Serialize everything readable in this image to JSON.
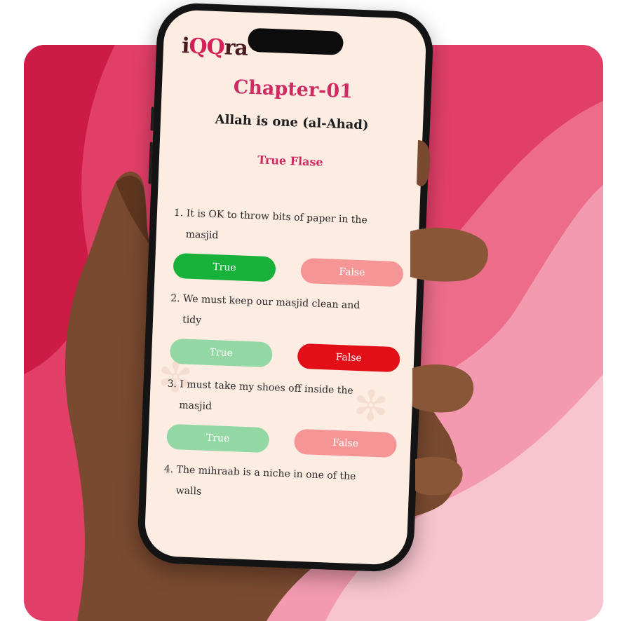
{
  "colors": {
    "background_pink": "#e7446d",
    "screen_bg": "#fdece2",
    "accent": "#cf2b63",
    "true_selected": "#18b23a",
    "true_unselected": "#93d8a4",
    "false_selected": "#e20f18",
    "false_unselected": "#f69595"
  },
  "app": {
    "logo_prefix": "i",
    "logo_q": "QQ",
    "logo_suffix": "ra"
  },
  "header": {
    "chapter": "Chapter-01",
    "subtitle": "Allah is one (al-Ahad)",
    "section": "True Flase"
  },
  "questions": [
    {
      "line1": "1. It is OK to throw bits of paper in the",
      "line2": "masjid",
      "true_label": "True",
      "false_label": "False",
      "selected": "true"
    },
    {
      "line1": "2. We must keep our masjid clean and",
      "line2": "tidy",
      "true_label": "True",
      "false_label": "False",
      "selected": "false"
    },
    {
      "line1": "3. I must take my shoes off inside the",
      "line2": "masjid",
      "true_label": "True",
      "false_label": "False",
      "selected": "none"
    },
    {
      "line1": "4. The mihraab is a niche in one of the",
      "line2": "walls"
    }
  ]
}
